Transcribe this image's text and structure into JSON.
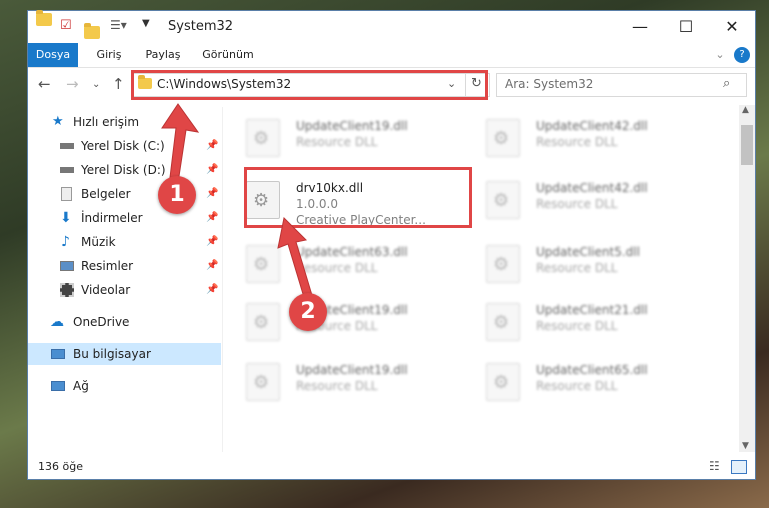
{
  "window": {
    "title": "System32"
  },
  "ribbon": {
    "tabs": [
      "Dosya",
      "Giriş",
      "Paylaş",
      "Görünüm"
    ]
  },
  "address": {
    "path": "C:\\Windows\\System32"
  },
  "search": {
    "placeholder": "Ara: System32"
  },
  "sidebar": {
    "quick_access": "Hızlı erişim",
    "items": [
      "Yerel Disk (C:)",
      "Yerel Disk (D:)",
      "Belgeler",
      "İndirmeler",
      "Müzik",
      "Resimler",
      "Videolar"
    ],
    "onedrive": "OneDrive",
    "this_pc": "Bu bilgisayar",
    "network": "Ağ"
  },
  "files": [
    {
      "name": "UpdateClient19.dll",
      "desc": "Resource DLL"
    },
    {
      "name": "UpdateClient42.dll",
      "desc": "Resource DLL"
    },
    {
      "name": "drv10kx.dll",
      "version": "1.0.0.0",
      "desc": "Creative PlayCenter..."
    },
    {
      "name": "UpdateClient42.dll",
      "desc": "Resource DLL"
    },
    {
      "name": "UpdateClient63.dll",
      "desc": "Resource DLL"
    },
    {
      "name": "UpdateClient5.dll",
      "desc": "Resource DLL"
    },
    {
      "name": "UpdateClient19.dll",
      "desc": "Resource DLL"
    },
    {
      "name": "UpdateClient21.dll",
      "desc": "Resource DLL"
    },
    {
      "name": "UpdateClient19.dll",
      "desc": "Resource DLL"
    },
    {
      "name": "UpdateClient65.dll",
      "desc": "Resource DLL"
    }
  ],
  "status": {
    "count": "136 öğe"
  },
  "annotations": {
    "step1": "1",
    "step2": "2"
  },
  "colors": {
    "accent": "#1979ca",
    "highlight": "#e04646",
    "selected": "#cce8ff"
  }
}
